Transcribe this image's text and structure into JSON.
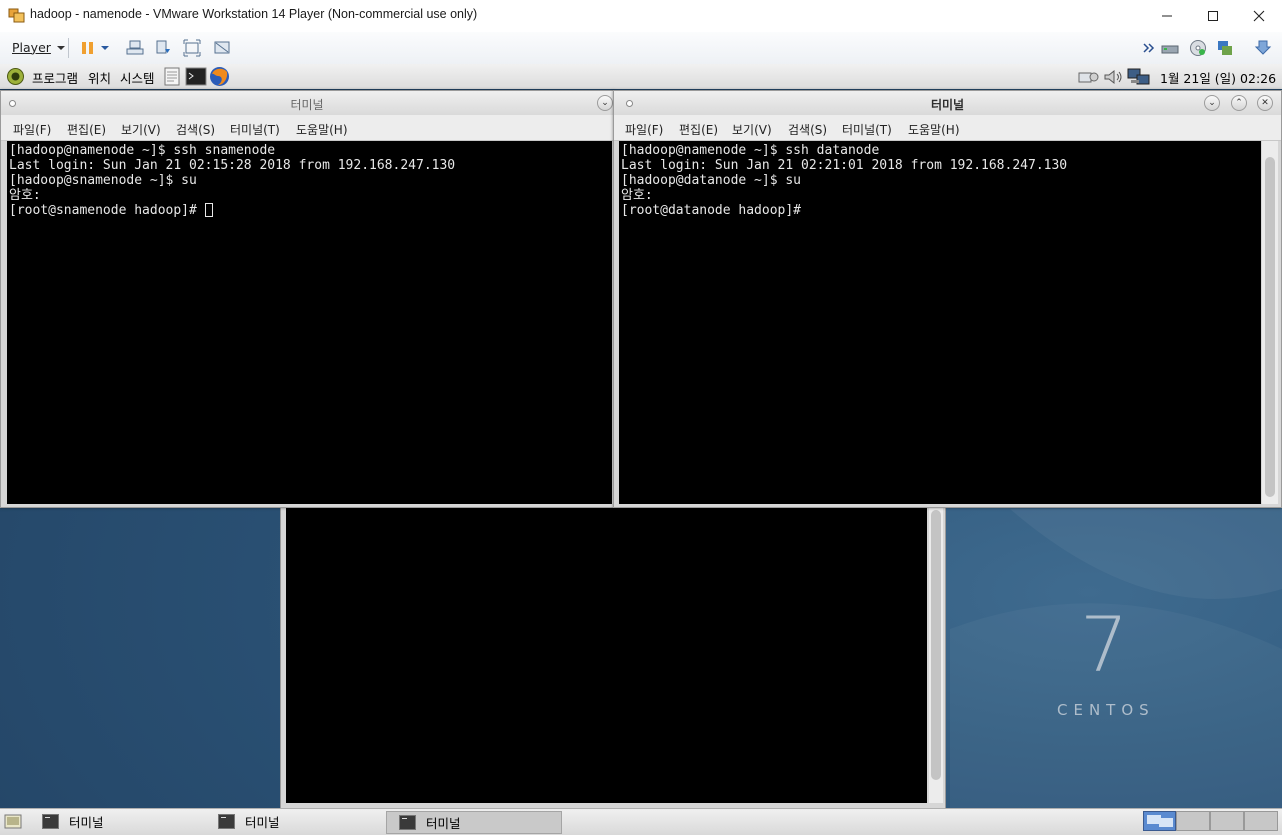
{
  "window": {
    "title": "hadoop - namenode - VMware Workstation 14 Player (Non-commercial use only)",
    "minimize_icon": "minimize-icon",
    "maximize_icon": "maximize-icon",
    "close_icon": "close-icon"
  },
  "toolbar": {
    "player_label": "Player",
    "icons": [
      "pause-icon",
      "send-ctrl-alt-del-icon",
      "removable-devices-icon",
      "fullscreen-icon",
      "unity-icon",
      "network-adapter-icon",
      "cd-drive-icon",
      "usb-icon",
      "download-icon"
    ]
  },
  "guest_panel": {
    "menu_program": "프로그램",
    "menu_location": "위치",
    "menu_system": "시스템",
    "clock": "1월 21일 (일) 02:26"
  },
  "terminal_left": {
    "title": "터미널",
    "menus": [
      "파일(F)",
      "편집(E)",
      "보기(V)",
      "검색(S)",
      "터미널(T)",
      "도움말(H)"
    ],
    "lines": [
      "[hadoop@namenode ~]$ ssh snamenode",
      "Last login: Sun Jan 21 02:15:28 2018 from 192.168.247.130",
      "[hadoop@snamenode ~]$ su",
      "암호:",
      "[root@snamenode hadoop]# "
    ]
  },
  "terminal_right": {
    "title": "터미널",
    "menus": [
      "파일(F)",
      "편집(E)",
      "보기(V)",
      "검색(S)",
      "터미널(T)",
      "도움말(H)"
    ],
    "lines": [
      "[hadoop@namenode ~]$ ssh datanode",
      "Last login: Sun Jan 21 02:21:01 2018 from 192.168.247.130",
      "[hadoop@datanode ~]$ su",
      "암호:",
      "[root@datanode hadoop]# "
    ]
  },
  "wallpaper": {
    "number": "7",
    "brand": "CENTOS"
  },
  "taskbar": {
    "tasks": [
      "터미널",
      "터미널",
      "터미널"
    ]
  }
}
